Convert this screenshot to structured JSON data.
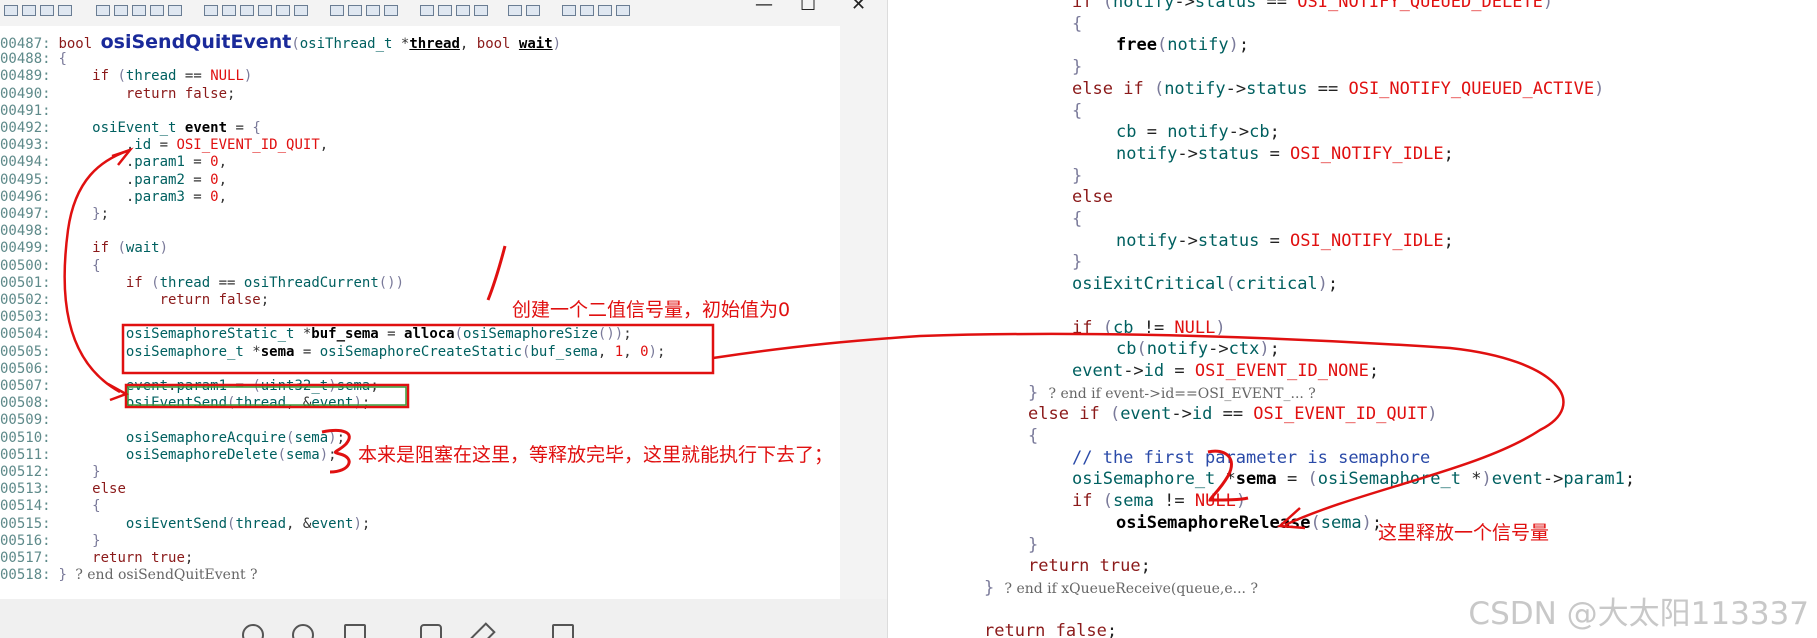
{
  "left_window": {
    "controls": {
      "minimize": "—",
      "maximize": "☐",
      "close": "✕"
    },
    "lines": [
      {
        "num": "00487:",
        "html": "<span class=\"kw\">bool</span> <span class=\"big\">osiSendQuitEvent</span><span class=\"br\">(</span><span class=\"type\">osiThread_t</span> *<span class=\"fnb ul\">thread</span>, <span class=\"kw\">bool</span> <span class=\"fnb ul\">wait</span><span class=\"br\">)</span>"
      },
      {
        "num": "00488:",
        "html": "<span class=\"br\">{</span>"
      },
      {
        "num": "00489:",
        "html": "    <span class=\"kw\">if</span> <span class=\"br\">(</span><span class=\"fn\">thread</span> == <span class=\"mac\">NULL</span><span class=\"br\">)</span>"
      },
      {
        "num": "00490:",
        "html": "        <span class=\"kw\">return</span> <span class=\"kw\">false</span>;"
      },
      {
        "num": "00491:",
        "html": ""
      },
      {
        "num": "00492:",
        "html": "    <span class=\"type\">osiEvent_t</span> <span class=\"fnb\">event</span> = <span class=\"br\">{</span>"
      },
      {
        "num": "00493:",
        "html": "        .<span class=\"fn\">id</span> = <span class=\"mac\">OSI_EVENT_ID_QUIT</span>,"
      },
      {
        "num": "00494:",
        "html": "        .<span class=\"fn\">param1</span> = <span class=\"num\">0</span>,"
      },
      {
        "num": "00495:",
        "html": "        .<span class=\"fn\">param2</span> = <span class=\"num\">0</span>,"
      },
      {
        "num": "00496:",
        "html": "        .<span class=\"fn\">param3</span> = <span class=\"num\">0</span>,"
      },
      {
        "num": "00497:",
        "html": "    <span class=\"br\">}</span>;"
      },
      {
        "num": "00498:",
        "html": ""
      },
      {
        "num": "00499:",
        "html": "    <span class=\"kw\">if</span> <span class=\"br\">(</span><span class=\"fn\">wait</span><span class=\"br\">)</span>"
      },
      {
        "num": "00500:",
        "html": "    <span class=\"br\">{</span>"
      },
      {
        "num": "00501:",
        "html": "        <span class=\"kw\">if</span> <span class=\"br\">(</span><span class=\"fn\">thread</span> == <span class=\"fn\">osiThreadCurrent</span><span class=\"br\">())</span>"
      },
      {
        "num": "00502:",
        "html": "            <span class=\"kw\">return</span> <span class=\"kw\">false</span>;"
      },
      {
        "num": "00503:",
        "html": ""
      },
      {
        "num": "00504:",
        "html": "        <span class=\"type\">osiSemaphoreStatic_t</span> *<span class=\"fnb\">buf_sema</span> = <span class=\"fnb\">alloca</span><span class=\"br\">(</span><span class=\"fn\">osiSemaphoreSize</span><span class=\"br\">())</span>;"
      },
      {
        "num": "00505:",
        "html": "        <span class=\"type\">osiSemaphore_t</span> *<span class=\"fnb\">sema</span> = <span class=\"fn\">osiSemaphoreCreateStatic</span><span class=\"br\">(</span><span class=\"fn\">buf_sema</span>, <span class=\"num\">1</span>, <span class=\"num\">0</span><span class=\"br\">)</span>;"
      },
      {
        "num": "00506:",
        "html": ""
      },
      {
        "num": "00507:",
        "html": "        <span class=\"fn\">event</span>.<span class=\"fn\">param1</span> = <span class=\"br\">(</span><span class=\"type\">uint32_t</span><span class=\"br\">)</span><span class=\"fn\">sema</span>;"
      },
      {
        "num": "00508:",
        "html": "        <span class=\"fn\">osiEventSend</span><span class=\"br\">(</span><span class=\"fn\">thread</span>, &amp;<span class=\"fn\">event</span><span class=\"br\">)</span>;"
      },
      {
        "num": "00509:",
        "html": ""
      },
      {
        "num": "00510:",
        "html": "        <span class=\"fn\">osiSemaphoreAcquire</span><span class=\"br\">(</span><span class=\"fn\">sema</span><span class=\"br\">)</span>;"
      },
      {
        "num": "00511:",
        "html": "        <span class=\"fn\">osiSemaphoreDelete</span><span class=\"br\">(</span><span class=\"fn\">sema</span><span class=\"br\">)</span>;"
      },
      {
        "num": "00512:",
        "html": "    <span class=\"br\">}</span>"
      },
      {
        "num": "00513:",
        "html": "    <span class=\"kw\">else</span>"
      },
      {
        "num": "00514:",
        "html": "    <span class=\"br\">{</span>"
      },
      {
        "num": "00515:",
        "html": "        <span class=\"fn\">osiEventSend</span><span class=\"br\">(</span><span class=\"fn\">thread</span>, &amp;<span class=\"fn\">event</span><span class=\"br\">)</span>;"
      },
      {
        "num": "00516:",
        "html": "    <span class=\"br\">}</span>"
      },
      {
        "num": "00517:",
        "html": "    <span class=\"kw\">return</span> <span class=\"kw\">true</span>;"
      },
      {
        "num": "00518:",
        "html": "<span class=\"br\">}</span> <span class=\"fold\">? end osiSendQuitEvent ?</span>"
      }
    ]
  },
  "right_pane": {
    "lines": [
      {
        "indent": 1,
        "html": "<span class=\"kw\">if</span> <span class=\"br\">(</span><span class=\"fn\">notify</span>-&gt;<span class=\"fn\">status</span> == <span class=\"mac\">OSI_NOTIFY_QUEUED_DELETE</span><span class=\"br\">)</span>"
      },
      {
        "indent": 1,
        "html": "<span class=\"br\">{</span>"
      },
      {
        "indent": 2,
        "html": "<span class=\"fnb\">free</span><span class=\"br\">(</span><span class=\"fn\">notify</span><span class=\"br\">)</span>;"
      },
      {
        "indent": 1,
        "html": "<span class=\"br\">}</span>"
      },
      {
        "indent": 1,
        "html": "<span class=\"kw\">else</span> <span class=\"kw\">if</span> <span class=\"br\">(</span><span class=\"fn\">notify</span>-&gt;<span class=\"fn\">status</span> == <span class=\"mac\">OSI_NOTIFY_QUEUED_ACTIVE</span><span class=\"br\">)</span>"
      },
      {
        "indent": 1,
        "html": "<span class=\"br\">{</span>"
      },
      {
        "indent": 2,
        "html": "<span class=\"fn\">cb</span> = <span class=\"fn\">notify</span>-&gt;<span class=\"fn\">cb</span>;"
      },
      {
        "indent": 2,
        "html": "<span class=\"fn\">notify</span>-&gt;<span class=\"fn\">status</span> = <span class=\"mac\">OSI_NOTIFY_IDLE</span>;"
      },
      {
        "indent": 1,
        "html": "<span class=\"br\">}</span>"
      },
      {
        "indent": 1,
        "html": "<span class=\"kw\">else</span>"
      },
      {
        "indent": 1,
        "html": "<span class=\"br\">{</span>"
      },
      {
        "indent": 2,
        "html": "<span class=\"fn\">notify</span>-&gt;<span class=\"fn\">status</span> = <span class=\"mac\">OSI_NOTIFY_IDLE</span>;"
      },
      {
        "indent": 1,
        "html": "<span class=\"br\">}</span>"
      },
      {
        "indent": 1,
        "html": "<span class=\"fn\">osiExitCritical</span><span class=\"br\">(</span><span class=\"fn\">critical</span><span class=\"br\">)</span>;"
      },
      {
        "indent": 1,
        "html": ""
      },
      {
        "indent": 1,
        "html": "<span class=\"kw\">if</span> <span class=\"br\">(</span><span class=\"fn\">cb</span> != <span class=\"mac\">NULL</span><span class=\"br\">)</span>"
      },
      {
        "indent": 2,
        "html": "<span class=\"fn\">cb</span><span class=\"br\">(</span><span class=\"fn\">notify</span>-&gt;<span class=\"fn\">ctx</span><span class=\"br\">)</span>;"
      },
      {
        "indent": 1,
        "html": "<span class=\"fn\">event</span>-&gt;<span class=\"fn\">id</span> = <span class=\"mac\">OSI_EVENT_ID_NONE</span>;"
      },
      {
        "indent": 0,
        "html": "<span class=\"br\">}</span> <span class=\"fold\">? end if event-&gt;id==OSI_EVENT_... ?</span>"
      },
      {
        "indent": 0,
        "html": "<span class=\"kw\">else</span> <span class=\"kw\">if</span> <span class=\"br\">(</span><span class=\"fn\">event</span>-&gt;<span class=\"fn\">id</span> == <span class=\"mac\">OSI_EVENT_ID_QUIT</span><span class=\"br\">)</span>"
      },
      {
        "indent": 0,
        "html": "<span class=\"br\">{</span>"
      },
      {
        "indent": 1,
        "html": "<span class=\"cmt\">// the first parameter is semaphore</span>"
      },
      {
        "indent": 1,
        "html": "<span class=\"type\">osiSemaphore_t</span> *<span class=\"fnb\">sema</span> = <span class=\"br\">(</span><span class=\"type\">osiSemaphore_t</span> *<span class=\"br\">)</span><span class=\"fn\">event</span>-&gt;<span class=\"fn\">param1</span>;"
      },
      {
        "indent": 1,
        "html": "<span class=\"kw\">if</span> <span class=\"br\">(</span><span class=\"fn\">sema</span> != <span class=\"mac\">NULL</span><span class=\"br\">)</span>"
      },
      {
        "indent": 2,
        "html": "<span class=\"fnb\">osiSemaphoreRelease</span><span class=\"br\">(</span><span class=\"fn\">sema</span><span class=\"br\">)</span>;"
      },
      {
        "indent": 0,
        "html": "<span class=\"br\">}</span>"
      },
      {
        "indent": 0,
        "html": "<span class=\"kw\">return</span> <span class=\"kw\">true</span>;"
      },
      {
        "indent": -1,
        "html": "<span class=\"br\">}</span> <span class=\"fold\">? end if xQueueReceive(queue,e... ?</span>"
      },
      {
        "indent": -1,
        "html": ""
      },
      {
        "indent": -1,
        "html": "<span class=\"kw\">return</span> <span class=\"kw\">false</span>;"
      }
    ]
  },
  "annotations": {
    "create_semaphore": "创建一个二值信号量，初始值为0",
    "blocked_here": "本来是阻塞在这里，等释放完毕，这里就能执行下去了；",
    "release_here": "这里释放一个信号量",
    "number_three": "3",
    "number_two": "2"
  },
  "watermark": "CSDN @大太阳113337"
}
